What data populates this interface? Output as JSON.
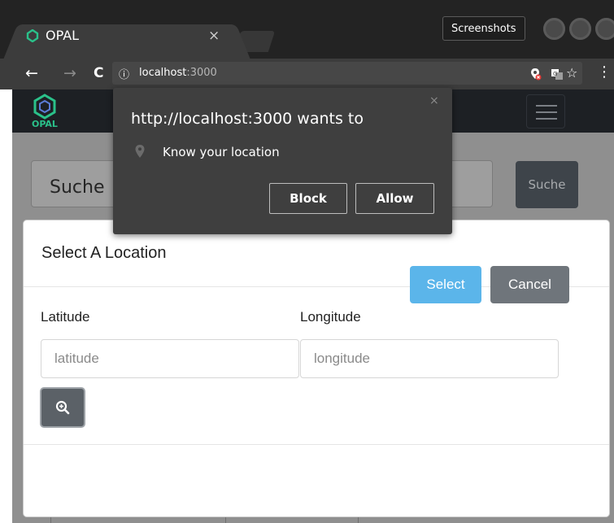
{
  "browser": {
    "tab_title": "OPAL",
    "tab_close": "×",
    "screenshots_label": "Screenshots",
    "url_info_icon": "ⓘ",
    "url_host": "localhost",
    "url_port": ":3000",
    "back_icon": "←",
    "forward_icon": "→",
    "reload_icon": "C",
    "star_icon": "☆",
    "menu_icon": "⋮"
  },
  "site": {
    "logo_text": "OPAL",
    "search_placeholder": "Suche",
    "search_button": "Suche"
  },
  "modal": {
    "title": "Select A Location",
    "latitude_label": "Latitude",
    "latitude_placeholder": "latitude",
    "longitude_label": "Longitude",
    "longitude_placeholder": "longitude",
    "select_button": "Select",
    "cancel_button": "Cancel"
  },
  "permission": {
    "title": "http://localhost:3000 wants to",
    "request": "Know your location",
    "close": "×",
    "block_button": "Block",
    "allow_button": "Allow"
  },
  "colors": {
    "primary_button": "#5bb5ea",
    "secondary_button": "#6f757b",
    "logo_accent": "#2ac18a"
  }
}
